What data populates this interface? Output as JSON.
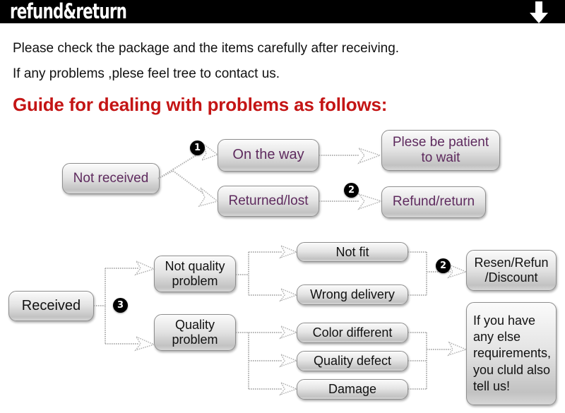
{
  "header": {
    "title": "refund&return",
    "arrow_icon": "down-arrow-icon"
  },
  "intro": {
    "line1": "Please check the package and the items carefully after receiving.",
    "line2": "If any problems ,plese feel tree to contact us."
  },
  "guide_heading": "Guide for dealing with problems as follows:",
  "colors": {
    "header_background": "#000000",
    "header_text": "#ffffff",
    "heading_red": "#c41515",
    "node_text_purple": "#5e2a5e",
    "node_text_black": "#111111",
    "connector_gray": "#b4b4b4",
    "badge_background": "#000000"
  },
  "flow_not_received": {
    "start": "Not received",
    "branches": [
      {
        "label": "On the way",
        "step": "1",
        "result": "Plese be patient to wait"
      },
      {
        "label": "Returned/lost",
        "step": "2",
        "result": "Refund/return"
      }
    ]
  },
  "flow_received": {
    "start": "Received",
    "step": "3",
    "categories": [
      {
        "label": "Not quality problem",
        "reasons": [
          "Not fit",
          "Wrong delivery"
        ]
      },
      {
        "label": "Quality problem",
        "reasons": [
          "Color different",
          "Quality defect",
          "Damage"
        ]
      }
    ],
    "outcomes": [
      {
        "step": "2",
        "label": "Resen/Refun /Discount"
      },
      {
        "step": "",
        "label": "If you have any else requirements, you cluld also tell us!"
      }
    ]
  }
}
